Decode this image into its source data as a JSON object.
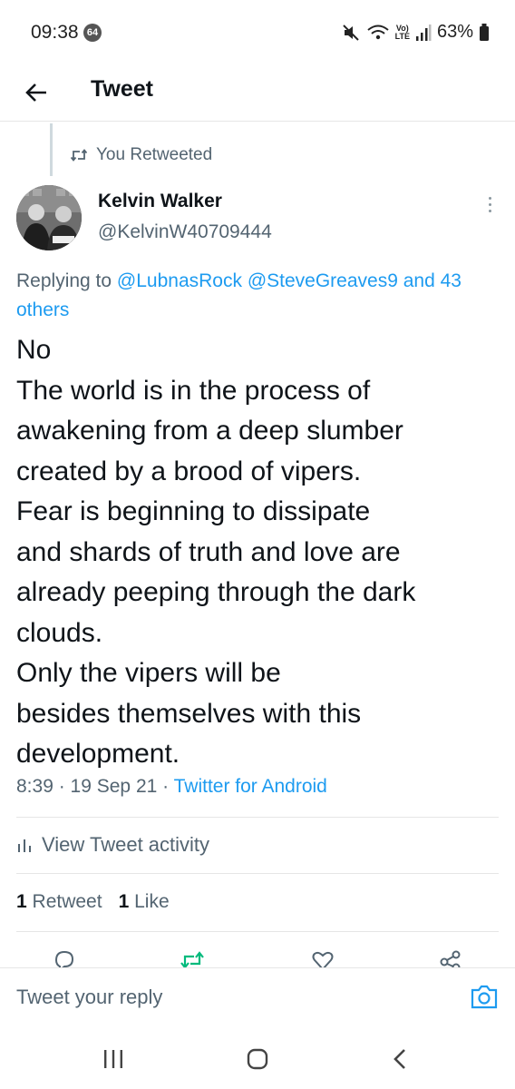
{
  "status_bar": {
    "time": "09:38",
    "notification_badge": "64",
    "volte_top": "Vo)",
    "volte_bottom": "LTE",
    "battery": "63%"
  },
  "header": {
    "title": "Tweet"
  },
  "retweet_context": {
    "label": "You Retweeted"
  },
  "author": {
    "name": "Kelvin Walker",
    "handle": "@KelvinW40709444"
  },
  "reply": {
    "prefix": "Replying to",
    "mention_1": "@LubnasRock",
    "mention_2": "@SteveGreaves9",
    "suffix_and": "and",
    "others": "43 others"
  },
  "tweet": {
    "lines": [
      "No",
      "The world is in the process of",
      "awakening from a deep slumber",
      "created by a brood of vipers.",
      "Fear is beginning to dissipate",
      "and shards of truth and love are",
      "already peeping through the dark",
      "clouds.",
      "Only the vipers will be",
      "besides themselves with this",
      "development."
    ],
    "time": "8:39",
    "date": "19 Sep 21",
    "source": "Twitter for Android"
  },
  "activity": {
    "label": "View Tweet activity"
  },
  "stats": {
    "retweet_count": "1",
    "retweet_label": "Retweet",
    "like_count": "1",
    "like_label": "Like"
  },
  "reply_bar": {
    "placeholder": "Tweet your reply"
  },
  "colors": {
    "link": "#1d9bf0",
    "secondary_text": "#536471",
    "retweet_green": "#00ba7c"
  }
}
